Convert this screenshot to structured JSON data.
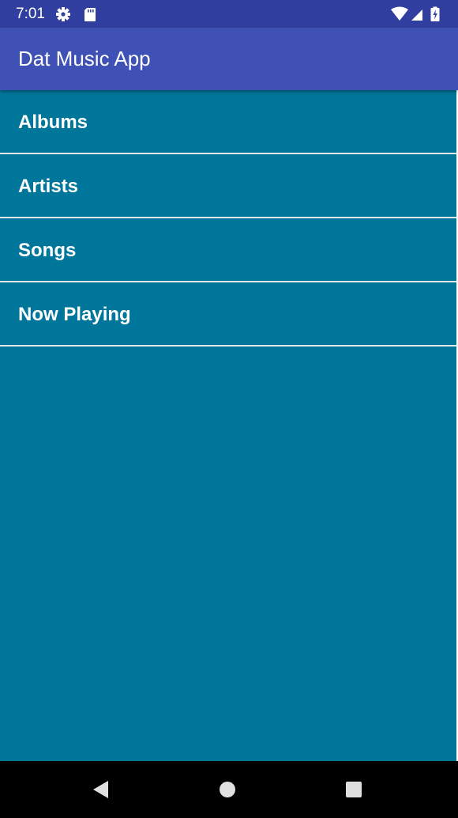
{
  "status_bar": {
    "time": "7:01",
    "icons": [
      "settings-icon",
      "sd-card-icon",
      "wifi-icon",
      "cell-signal-icon",
      "battery-charging-icon"
    ],
    "background": "#303F9F"
  },
  "app_bar": {
    "title": "Dat Music App",
    "background": "#3F51B5"
  },
  "menu": {
    "background": "#00769A",
    "items": [
      {
        "label": "Albums"
      },
      {
        "label": "Artists"
      },
      {
        "label": "Songs"
      },
      {
        "label": "Now Playing"
      }
    ]
  },
  "nav_bar": {
    "buttons": [
      "back-icon",
      "home-icon",
      "recents-icon"
    ]
  }
}
